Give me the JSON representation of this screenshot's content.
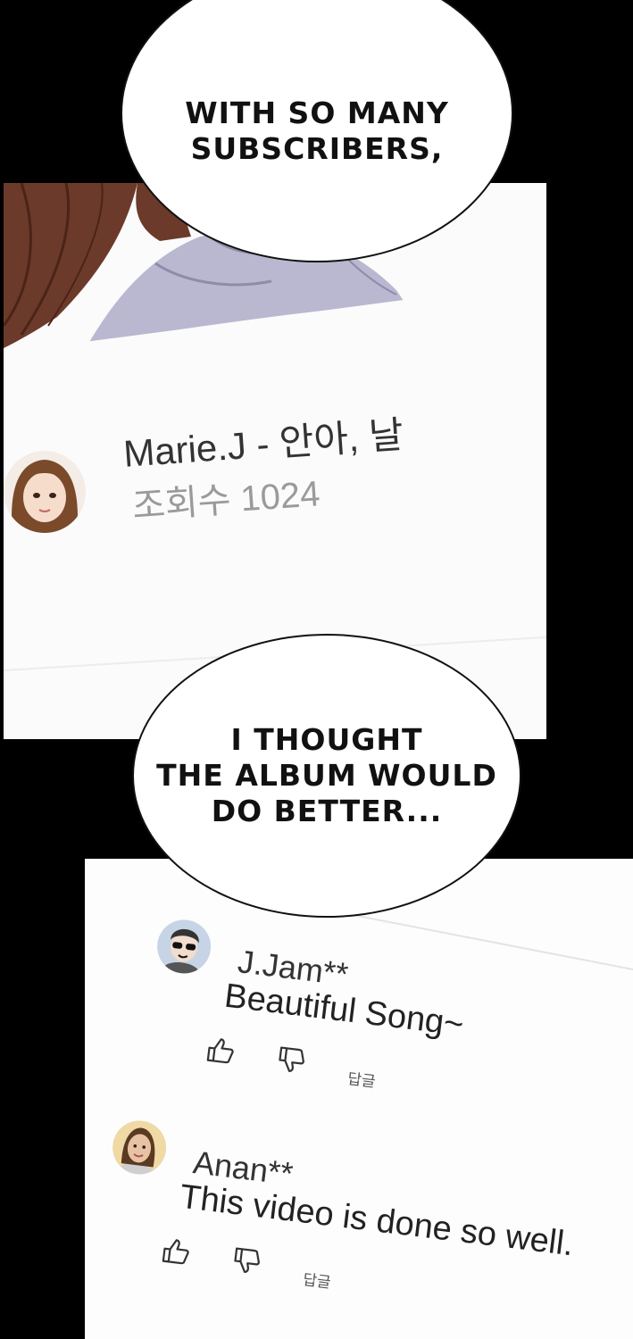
{
  "bubbles": [
    {
      "text": "WITH SO MANY\nSUBSCRIBERS,"
    },
    {
      "text": "I THOUGHT\nTHE ALBUM WOULD\nDO BETTER..."
    }
  ],
  "video": {
    "title": "Marie.J - 안아, 날",
    "views": "조회수 1024"
  },
  "comments": [
    {
      "author": "J.Jam**",
      "text": "Beautiful Song~",
      "reply_label": "답글"
    },
    {
      "author": "Anan**",
      "text": "This video is done so well.",
      "reply_label": "답글"
    }
  ],
  "colors": {
    "background": "#000000",
    "panel": "#fbfbfb",
    "title_text": "#333333",
    "views_text": "#9a9a9a",
    "hair": "#6b3a2a",
    "shirt": "#b9b8d0"
  },
  "icons": [
    "thumbs-up-icon",
    "thumbs-down-icon"
  ]
}
